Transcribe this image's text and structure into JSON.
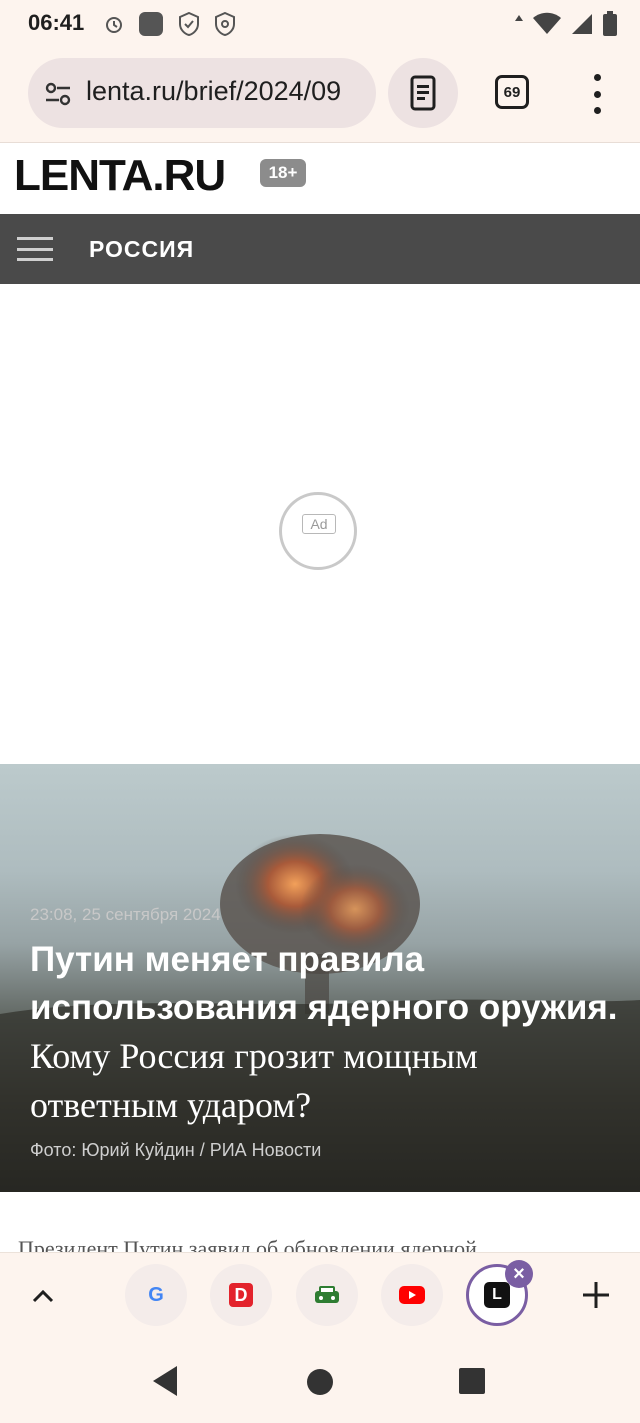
{
  "status_bar": {
    "time": "06:41",
    "icons": [
      "alarm-icon",
      "app-notification-icon",
      "vpn-shield-icon",
      "security-shield-icon",
      "data-arrows-icon",
      "wifi-icon",
      "signal-icon",
      "battery-icon"
    ]
  },
  "browser": {
    "url": "lenta.ru/brief/2024/09",
    "tab_count": "69"
  },
  "site": {
    "logo": "LENTA.RU",
    "age_rating": "18+",
    "section": "РОССИЯ"
  },
  "ad": {
    "label": "Ad"
  },
  "hero": {
    "date": "23:08, 25 сентября 2024",
    "headline": "Путин меняет правила использования ядерного оружия.",
    "subheadline": "Кому Россия грозит мощным ответным ударом?",
    "photo_credit": "Фото: Юрий Куйдин / РИА Новости"
  },
  "article": {
    "peek_text": "Президент Путин заявил об обновлении ядерной"
  },
  "tab_strip": {
    "tabs": [
      {
        "name": "google",
        "glyph": "G",
        "color": "#4285f4"
      },
      {
        "name": "dns",
        "glyph": "D",
        "color": "#e3232c"
      },
      {
        "name": "drom",
        "glyph": "🚙",
        "color": "#2e7d32"
      },
      {
        "name": "youtube",
        "glyph": "▶",
        "color": "#ff0000"
      },
      {
        "name": "lenta",
        "glyph": "L",
        "color": "#111111"
      }
    ]
  },
  "colors": {
    "chrome_bg": "#fdf4ee",
    "nav_bg": "#4a4a4a",
    "accent": "#7a5ea3"
  }
}
